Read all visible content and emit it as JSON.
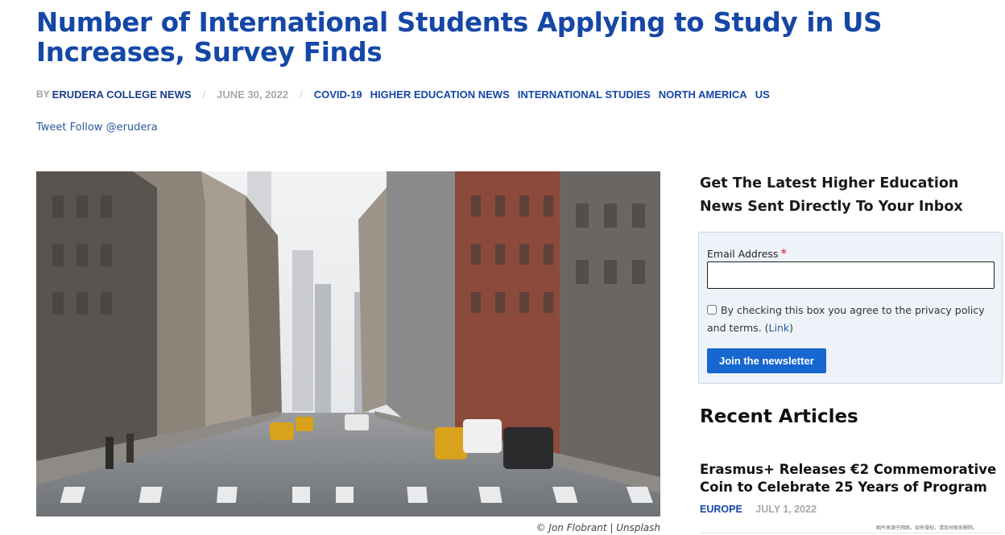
{
  "article": {
    "title": "Number of International Students Applying to Study in US Increases, Survey Finds",
    "byline_prefix": "BY",
    "author": "ERUDERA COLLEGE NEWS",
    "date": "JUNE 30, 2022",
    "categories": [
      "COVID-19",
      "HIGHER EDUCATION NEWS",
      "INTERNATIONAL STUDIES",
      "NORTH AMERICA",
      "US"
    ],
    "social": {
      "tweet": "Tweet",
      "follow": "Follow @erudera"
    },
    "image_caption": "© Jon Flobrant | Unsplash"
  },
  "sidebar": {
    "newsletter_title": "Get The Latest Higher Education News Sent Directly To Your Inbox",
    "email_label": "Email Address",
    "required_marker": "*",
    "email_value": "",
    "consent_text": "By checking this box you agree to the privacy policy and terms.",
    "consent_link_open": "(",
    "consent_link": "Link",
    "consent_link_close": ")",
    "join_button": "Join the newsletter",
    "recent_title": "Recent Articles",
    "recent": [
      {
        "title": "Erasmus+ Releases €2 Commemorative Coin to Celebrate 25 Years of Program",
        "category": "EUROPE",
        "date": "JULY 1, 2022"
      }
    ],
    "watermark": "图片来源于网络，如有侵权，请及时联系删除。"
  },
  "colors": {
    "accent": "#1547a6",
    "button": "#1667d0",
    "form_bg": "#eef3f9"
  },
  "icons": {
    "required": "asterisk",
    "consent": "checkbox"
  }
}
